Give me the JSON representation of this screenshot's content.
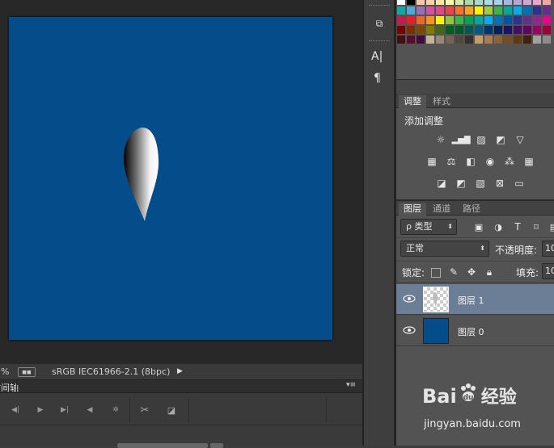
{
  "status": {
    "zoom_suffix": "%",
    "profile": "sRGB IEC61966-2.1 (8bpc)"
  },
  "timeline": {
    "title": "时间轴"
  },
  "tools": {
    "type_icon": "A|",
    "paragraph_icon": "¶"
  },
  "swatches": {
    "rows": [
      [
        "#ffffff",
        "#000000",
        "#f6c9a8",
        "#f9d2a6",
        "#fbe5a6",
        "#fdf8a6",
        "#d4eaa6",
        "#aed9a6",
        "#a6d9c9",
        "#a6dde3",
        "#a6cfea",
        "#a6b5dd",
        "#b2a6d6",
        "#d0a6d6",
        "#eba6cf",
        "#f3a6a6"
      ],
      [
        "#15a7a6",
        "#4fa8d6",
        "#9b6fb5",
        "#d84f9e",
        "#e8468a",
        "#ed4445",
        "#f4732c",
        "#f9a31c",
        "#fff100",
        "#9fcb45",
        "#3bb34a",
        "#00a99d",
        "#00aeef",
        "#0072bc",
        "#2e3192",
        "#662d91"
      ],
      [
        "#c51a4a",
        "#ee1c24",
        "#f26522",
        "#f7941d",
        "#fff200",
        "#8dc63f",
        "#39b54a",
        "#00a651",
        "#00a99d",
        "#00aeef",
        "#0072bc",
        "#0054a6",
        "#2e3192",
        "#662d91",
        "#92278f",
        "#ec008c"
      ],
      [
        "#790000",
        "#7b2e00",
        "#7d4900",
        "#827b00",
        "#406618",
        "#005e20",
        "#005826",
        "#005952",
        "#005b7f",
        "#003471",
        "#002157",
        "#1b1464",
        "#440e62",
        "#630460",
        "#9e005d",
        "#9e0039"
      ],
      [
        "#421010",
        "#560e2c",
        "#3f0d3a",
        "#c2b59b",
        "#998675",
        "#736357",
        "#534741",
        "#362f2d",
        "#c69c6d",
        "#a67c52",
        "#8c6239",
        "#754c24",
        "#603913",
        "#42210b",
        "#a1a1a1",
        "#8c8c8c"
      ]
    ]
  },
  "adjustments": {
    "tabs": [
      "调整",
      "样式"
    ],
    "title": "添加调整",
    "row1": [
      "brightness-icon",
      "levels-icon",
      "curves-icon",
      "exposure-icon",
      "vibrance-icon"
    ],
    "row2": [
      "hue-saturation-icon",
      "color-balance-icon",
      "black-white-icon",
      "photo-filter-icon",
      "channel-mixer-icon",
      "color-lookup-icon"
    ],
    "row3": [
      "invert-icon",
      "posterize-icon",
      "threshold-icon",
      "selective-color-icon",
      "gradient-map-icon"
    ]
  },
  "layers": {
    "tabs": [
      "图层",
      "通道",
      "路径"
    ],
    "filter_label": "ρ 类型",
    "blend_mode": "正常",
    "opacity_label": "不透明度:",
    "opacity_value": "10",
    "lock_label": "锁定:",
    "fill_label": "填充:",
    "fill_value": "10",
    "items": [
      {
        "name": "图层 1",
        "selected": true
      },
      {
        "name": "图层 0",
        "selected": false
      }
    ]
  },
  "watermark": {
    "brand": "Bai",
    "brand2": "du",
    "product": "经验",
    "url": "jingyan.baidu.com"
  },
  "colors": {
    "canvas": "#054c8a",
    "selected_row": "#6c7d96"
  }
}
